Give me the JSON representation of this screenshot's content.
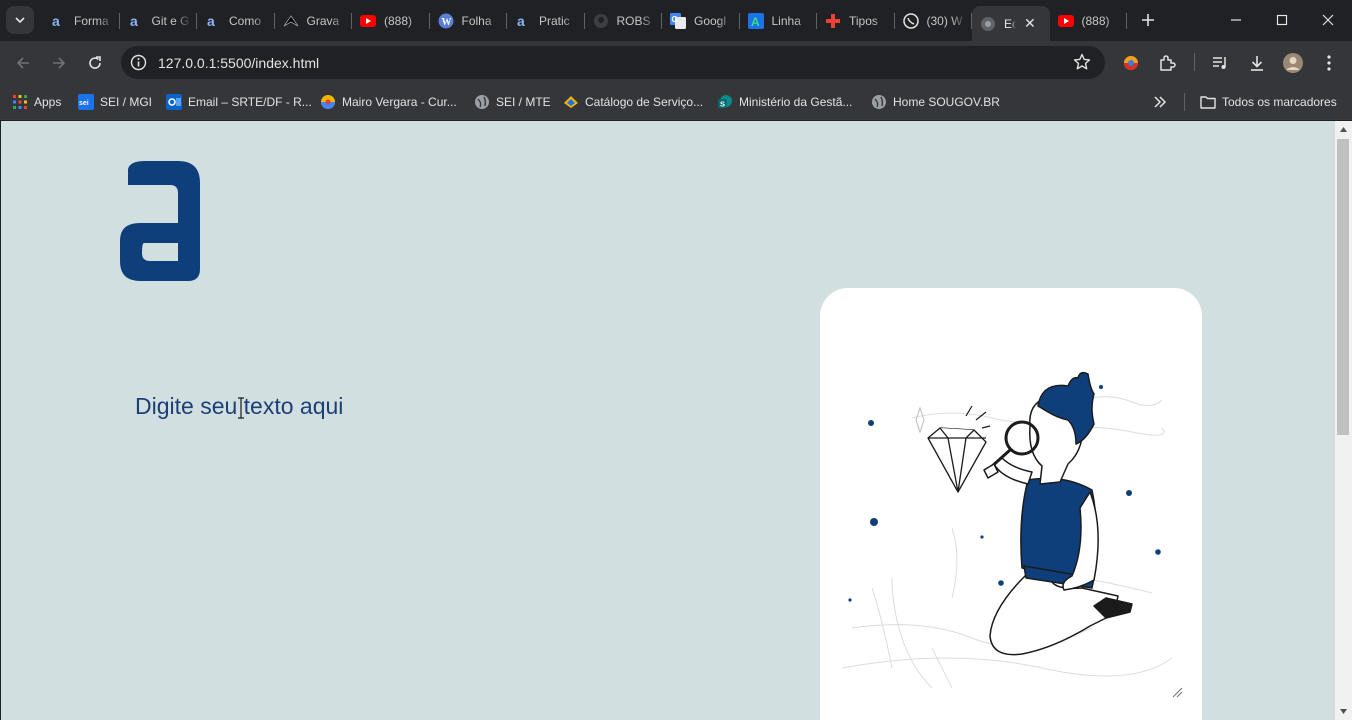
{
  "browser": {
    "tabs": [
      {
        "title": "Forma",
        "icon": "alura-icon"
      },
      {
        "title": "Git e G",
        "icon": "alura-icon"
      },
      {
        "title": "Como",
        "icon": "alura-icon"
      },
      {
        "title": "Grava",
        "icon": "gravacao-icon"
      },
      {
        "title": "(888)",
        "icon": "youtube-icon"
      },
      {
        "title": "Folha",
        "icon": "wordpress-icon"
      },
      {
        "title": "Pratic",
        "icon": "alura-icon"
      },
      {
        "title": "ROBS",
        "icon": "github-icon"
      },
      {
        "title": "Googl",
        "icon": "google-translate-icon"
      },
      {
        "title": "Linha",
        "icon": "linha-icon"
      },
      {
        "title": "Tipos",
        "icon": "plus-icon"
      },
      {
        "title": "(30) W",
        "icon": "whatsapp-icon"
      },
      {
        "title": "Ec",
        "icon": "globe-icon",
        "active": true
      },
      {
        "title": "(888)",
        "icon": "youtube-icon"
      }
    ],
    "url": "127.0.0.1:5500/index.html",
    "bookmarks": [
      {
        "label": "Apps",
        "icon": "apps-grid-icon"
      },
      {
        "label": "SEI / MGI",
        "icon": "sei-icon"
      },
      {
        "label": "Email – SRTE/DF - R...",
        "icon": "outlook-icon"
      },
      {
        "label": "Mairo Vergara - Cur...",
        "icon": "mairo-icon"
      },
      {
        "label": "SEI / MTE",
        "icon": "globe-icon"
      },
      {
        "label": "Catálogo de Serviço...",
        "icon": "gov-icon"
      },
      {
        "label": "Ministério da Gestã...",
        "icon": "sharepoint-icon"
      },
      {
        "label": "Home SOUGOV.BR",
        "icon": "globe-icon"
      }
    ],
    "all_bookmarks_label": "Todos os marcadores"
  },
  "page": {
    "editor_text": "Digite seu texto aqui",
    "colors": {
      "background": "#d1dfe0",
      "accent": "#1c3f76",
      "card": "#ffffff"
    }
  }
}
